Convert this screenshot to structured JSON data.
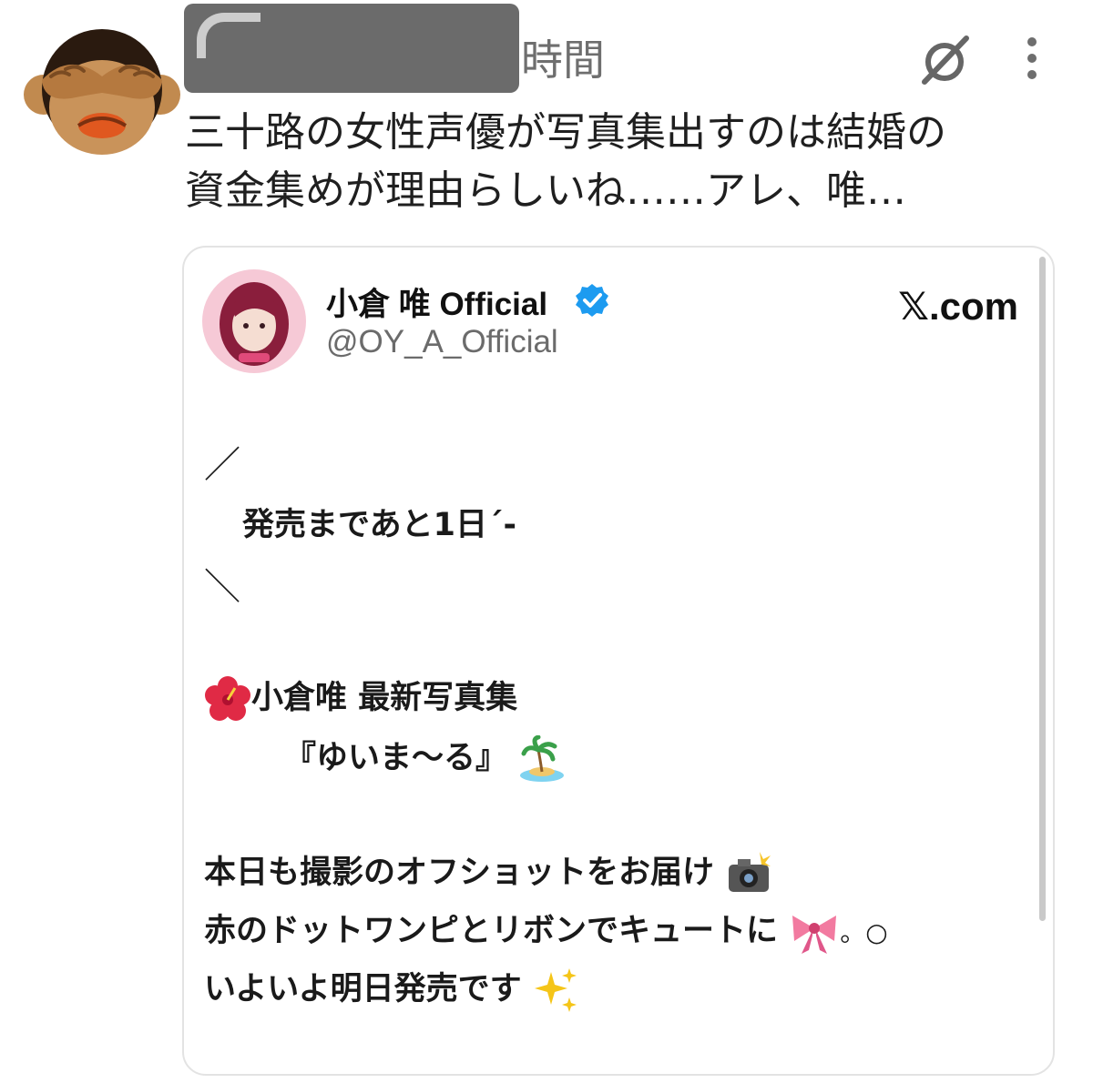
{
  "post": {
    "time_label": "時間",
    "text": "三十路の女性声優が写真集出すのは結婚の\n資金集めが理由らしいね……アレ、唯…"
  },
  "card": {
    "display_name": "小倉 唯 Official",
    "handle": "@OY_A_Official",
    "source": "𝕏.com",
    "lines": {
      "slash_top": "／",
      "countdown": "発売まであと1日´-",
      "slash_bottom": "＼",
      "title1": "小倉唯 最新写真集",
      "title2": "『ゆいま〜る』",
      "body1": "本日も撮影のオフショットをお届け",
      "body2": "赤のドットワンピとリボンでキュートに",
      "body2_tail": "。○",
      "body3": "いよいよ明日発売です"
    }
  },
  "icons": {
    "avatar": "see-no-evil-monkey-icon",
    "sync": "sync-off-icon",
    "more": "more-vertical-icon",
    "verified": "verified-badge-icon",
    "hibiscus": "hibiscus-icon",
    "island": "desert-island-icon",
    "camera": "camera-flash-icon",
    "ribbon": "ribbon-icon",
    "sparkles": "sparkles-icon"
  },
  "colors": {
    "verified_blue": "#1d9bf0",
    "redaction": "#6b6b6b",
    "monkey_brown": "#b5793f"
  }
}
